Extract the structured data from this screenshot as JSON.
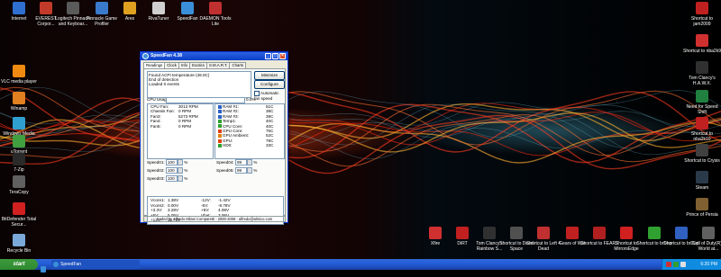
{
  "desktop": {
    "icons": [
      {
        "name": "Internet",
        "color": "#2f6fd0"
      },
      {
        "name": "EVEREST Corpor...",
        "color": "#c23a2a"
      },
      {
        "name": "Logitech Pinnacle and Keyboar...",
        "color": "#5a5a5a"
      },
      {
        "name": "Pinnacle Game Profiler",
        "color": "#3a7acc"
      },
      {
        "name": "Ares",
        "color": "#e0a020"
      },
      {
        "name": "RivaTuner",
        "color": "#d0d0d0"
      },
      {
        "name": "SpeedFan",
        "color": "#3a8fd8"
      },
      {
        "name": "DAEMON Tools Lite",
        "color": "#c03030"
      },
      {
        "name": "VLC media player",
        "color": "#f08a10"
      },
      {
        "name": "Winamp",
        "color": "#e08020"
      },
      {
        "name": "Windows Media Player",
        "color": "#2f9fd0"
      },
      {
        "name": "uTorrent",
        "color": "#40a040"
      },
      {
        "name": "7-Zip",
        "color": "#2a2a2a"
      },
      {
        "name": "TeraCopy",
        "color": "#606060"
      },
      {
        "name": "BitDefender Total Secur...",
        "color": "#d02020"
      },
      {
        "name": "Recycle Bin",
        "color": "#7aa8d8"
      },
      {
        "name": "Shortcut to jam2009",
        "color": "#c02020"
      },
      {
        "name": "Shortcut to nba2k9",
        "color": "#d03030"
      },
      {
        "name": "Tom Clancy's H.A.W.X.",
        "color": "#303030"
      },
      {
        "name": "Need for Speed Shift",
        "color": "#208040"
      },
      {
        "name": "Shortcut to nba2k10",
        "color": "#c02020"
      },
      {
        "name": "Shortcut to Crysis",
        "color": "#404040"
      },
      {
        "name": "Steam",
        "color": "#2a3a4a"
      },
      {
        "name": "Prince of Persia",
        "color": "#806030"
      },
      {
        "name": "Xfire",
        "color": "#d03030"
      },
      {
        "name": "DiRT",
        "color": "#c02020"
      },
      {
        "name": "Tom Clancy's Rainbow S...",
        "color": "#303030"
      },
      {
        "name": "Shortcut to Dead Space",
        "color": "#505050"
      },
      {
        "name": "Shortcut to Left 4 Dead",
        "color": "#c03030"
      },
      {
        "name": "Gears of War",
        "color": "#c02020"
      },
      {
        "name": "Shortcut to FEAR2",
        "color": "#b02020"
      },
      {
        "name": "Shortcut to MirrorsEdge",
        "color": "#d02020"
      },
      {
        "name": "Shortcut to brDep",
        "color": "#30a030"
      },
      {
        "name": "Shortcut to brDep",
        "color": "#3060c0"
      },
      {
        "name": "Call of Duty(R) - World at...",
        "color": "#606060"
      }
    ]
  },
  "window": {
    "title": "SpeedFan 4.38",
    "controls": {
      "minimize": "_",
      "maximize": "□",
      "close": "×"
    },
    "tabs": [
      "Readings",
      "Clock",
      "Info",
      "Exotics",
      "S.M.A.R.T.",
      "Charts"
    ],
    "log": [
      "Found ACPI temperature (49.0C)",
      "End of detection",
      "Loaded 0 events"
    ],
    "buttons": {
      "minimize": "Minimize",
      "configure": "Configure"
    },
    "checkbox": "Automatic fan speed",
    "cpu_usage_label": "CPU Usage",
    "cpu_usage_value": "0.0%",
    "fans": [
      {
        "name": "CPU Fan:",
        "value": "3013 RPM"
      },
      {
        "name": "Chassis Fan:",
        "value": "0 RPM"
      },
      {
        "name": "Fan3:",
        "value": "5273 RPM"
      },
      {
        "name": "Fan4:",
        "value": "0 RPM"
      },
      {
        "name": "Fan5:",
        "value": "0 RPM"
      }
    ],
    "temps": [
      {
        "name": "RAM #1:",
        "value": "51C",
        "icon_color": "#2a60c8"
      },
      {
        "name": "RAM #2:",
        "value": "38C",
        "icon_color": "#2a60c8"
      },
      {
        "name": "RAM #3:",
        "value": "39C",
        "icon_color": "#2a60c8"
      },
      {
        "name": "Temp1:",
        "value": "40C",
        "icon_color": "#30a030"
      },
      {
        "name": "CPU Core:",
        "value": "40C",
        "icon_color": "#30a030"
      },
      {
        "name": "GPU Core:",
        "value": "75C",
        "icon_color": "#e04010"
      },
      {
        "name": "GPU Ambient:",
        "value": "52C",
        "icon_color": "#e08010"
      },
      {
        "name": "GPU:",
        "value": "78C",
        "icon_color": "#e04010"
      },
      {
        "name": "HD0:",
        "value": "33C",
        "icon_color": "#30a030"
      }
    ],
    "speeds": [
      {
        "name": "Speed01:",
        "value": "100",
        "unit": "%"
      },
      {
        "name": "Speed02:",
        "value": "100",
        "unit": "%"
      },
      {
        "name": "Speed03:",
        "value": "100",
        "unit": "%"
      },
      {
        "name": "Speed04:",
        "value": "99",
        "unit": "%"
      },
      {
        "name": "Speed05:",
        "value": "99",
        "unit": "%"
      }
    ],
    "voltages": [
      {
        "name": "Vcore1:",
        "value": "1.38V"
      },
      {
        "name": "Vcore2:",
        "value": "0.00V"
      },
      {
        "name": "+3.3V:",
        "value": "3.28V"
      },
      {
        "name": "+5V:",
        "value": "5.05V"
      },
      {
        "name": "+12V:",
        "value": "11.71V"
      },
      {
        "name": "-12V:",
        "value": "-1.42V"
      },
      {
        "name": "-5V:",
        "value": "-8.78V"
      },
      {
        "name": "+5V:",
        "value": "4.08V"
      },
      {
        "name": "Vbat:",
        "value": "3.06V"
      }
    ],
    "status": "Coded by Alfredo Milani Comparetti - 2000-2009 - alfredo@almico.com"
  },
  "taskbar": {
    "start_label": "start",
    "task_label": "SpeedFan",
    "clock": "6:20 PM",
    "colors": {
      "bar": "#245edb",
      "start": "#2f8a2f",
      "tray": "#0f8be0"
    }
  }
}
